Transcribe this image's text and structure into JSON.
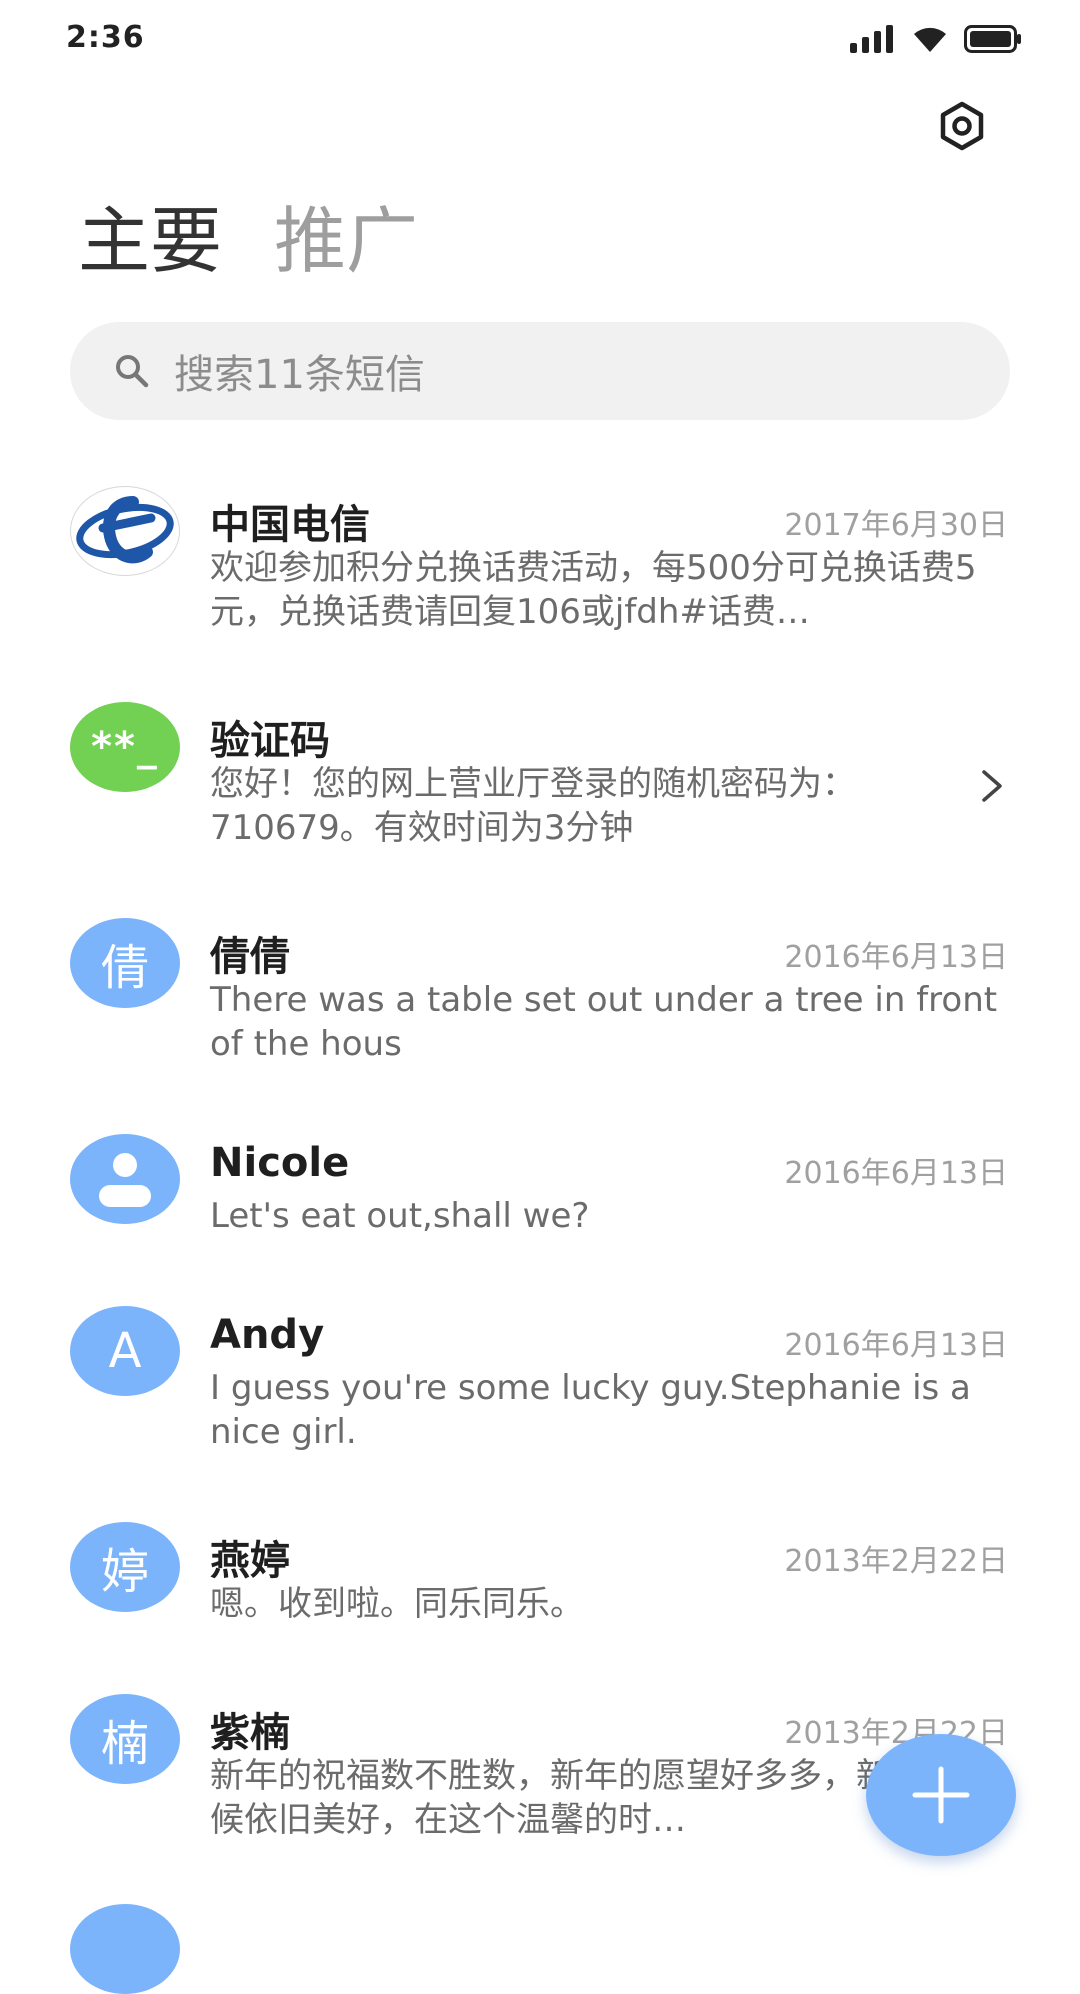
{
  "status_bar": {
    "time": "2:36"
  },
  "icons": {
    "settings": "hexagon-gear-icon",
    "search": "search-icon",
    "fab": "plus-icon",
    "signal": "signal-icon",
    "wifi": "wifi-icon",
    "battery": "battery-icon",
    "chevron": "chevron-right-icon"
  },
  "tabs": [
    {
      "label": "主要",
      "active": true
    },
    {
      "label": "推广",
      "active": false
    }
  ],
  "search": {
    "placeholder": "搜索11条短信"
  },
  "colors": {
    "avatar_blue": "#7cb4fb",
    "avatar_green": "#72d052",
    "fab": "#7cb4fb",
    "telecom_blue": "#1e56a8"
  },
  "conversations": [
    {
      "name": "中国电信",
      "date": "2017年6月30日",
      "avatar": "telecom-logo",
      "preview": "欢迎参加积分兑换话费活动，每500分可兑换话费5元，兑换话费请回复106或jfdh#话费…"
    },
    {
      "name": "验证码",
      "date": "",
      "avatar_text": "**_",
      "preview": "您好！您的网上营业厅登录的随机密码为：710679。有效时间为3分钟"
    },
    {
      "name": "倩倩",
      "date": "2016年6月13日",
      "avatar_text": "倩",
      "preview": "There was a table set out under a tree in front of the hous"
    },
    {
      "name": "Nicole",
      "date": "2016年6月13日",
      "avatar": "person-icon",
      "preview": "Let's eat out,shall we?"
    },
    {
      "name": "Andy",
      "date": "2016年6月13日",
      "avatar_text": "A",
      "preview": "I guess you're some lucky guy.Stephanie is a nice girl."
    },
    {
      "name": "燕婷",
      "date": "2013年2月22日",
      "avatar_text": "婷",
      "preview": "嗯。收到啦。同乐同乐。"
    },
    {
      "name": "紫楠",
      "date": "2013年2月22日",
      "avatar_text": "楠",
      "preview": "新年的祝福数不胜数，新年的愿望好多多，新年的问候依旧美好，在这个温馨的时…"
    }
  ]
}
